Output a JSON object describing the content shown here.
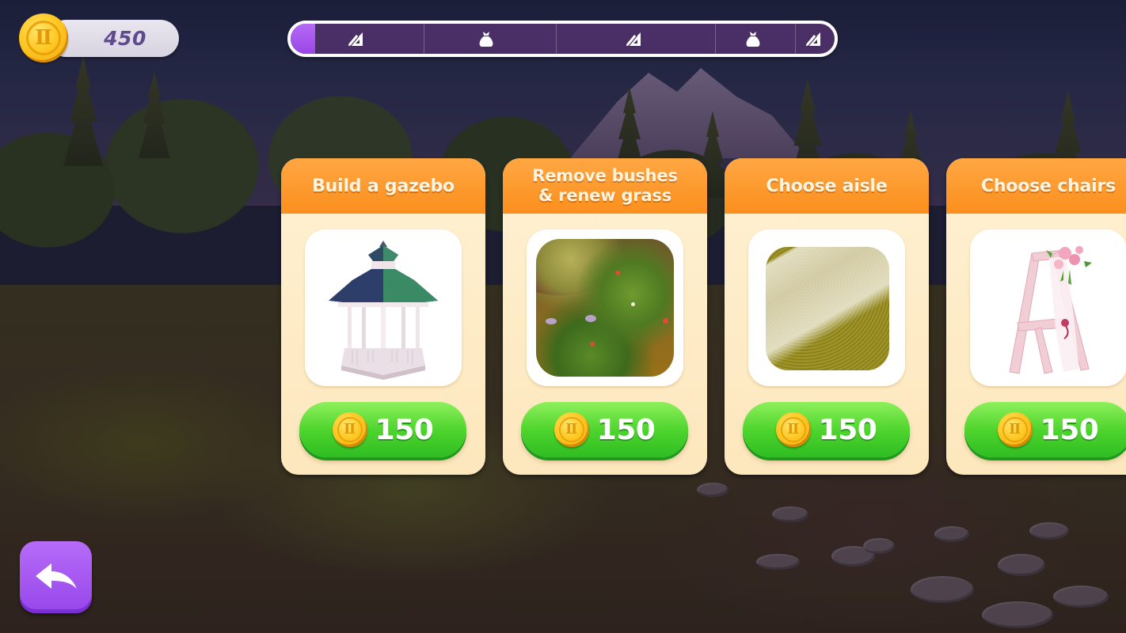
{
  "hud": {
    "coin_icon": "gold-coin-icon",
    "coin_balance": "450"
  },
  "progress": {
    "fill_fraction": 0.045,
    "milestones": [
      {
        "icon": "ruler-pencil-icon",
        "position_fraction": 0.12
      },
      {
        "icon": "money-bag-icon",
        "position_fraction": 0.36
      },
      {
        "icon": "ruler-pencil-icon",
        "position_fraction": 0.63
      },
      {
        "icon": "money-bag-icon",
        "position_fraction": 0.85
      },
      {
        "icon": "ruler-pencil-icon",
        "position_fraction": 0.96
      }
    ],
    "segment_boundaries_fraction": [
      0.245,
      0.487,
      0.78,
      0.927
    ]
  },
  "coin_symbol": "Ⅱ",
  "tasks": [
    {
      "title": "Build a gazebo",
      "image": "gazebo",
      "price": "150",
      "currency_icon": "gold-coin-icon"
    },
    {
      "title": "Remove bushes & renew grass",
      "title_lines": [
        "Remove bushes",
        "& renew grass"
      ],
      "image": "bushes",
      "price": "150",
      "currency_icon": "gold-coin-icon"
    },
    {
      "title": "Choose aisle",
      "image": "aisle",
      "price": "150",
      "currency_icon": "gold-coin-icon"
    },
    {
      "title": "Choose chairs",
      "image": "chair",
      "price": "150",
      "currency_icon": "gold-coin-icon"
    }
  ],
  "back_button": {
    "icon": "back-arrow-icon"
  },
  "colors": {
    "accent_purple": "#9a45e6",
    "header_orange": "#fb8f1d",
    "buy_green": "#4fd52e",
    "card_cream": "#fff1d2",
    "balance_text": "#5f4a8e"
  }
}
